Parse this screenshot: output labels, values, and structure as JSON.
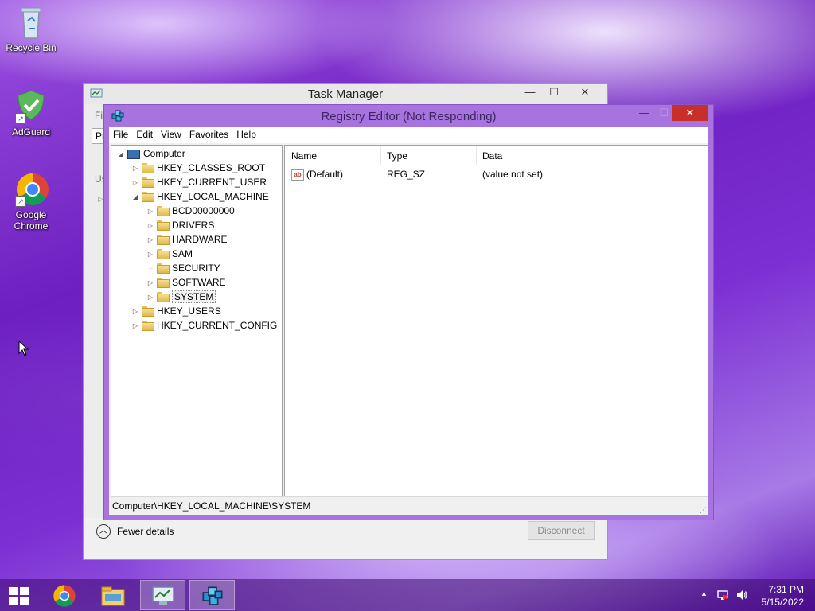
{
  "desktop": {
    "icons": [
      {
        "label": "Recycle Bin"
      },
      {
        "label": "AdGuard"
      },
      {
        "label": "Google Chrome"
      }
    ]
  },
  "task_manager": {
    "title": "Task Manager",
    "fragments": {
      "menu": "Fi",
      "tab": "Pr",
      "user": "Us"
    },
    "fewer_details": "Fewer details",
    "disconnect_label": "Disconnect"
  },
  "registry_editor": {
    "title": "Registry Editor (Not Responding)",
    "menu": [
      "File",
      "Edit",
      "View",
      "Favorites",
      "Help"
    ],
    "tree": {
      "root": "Computer",
      "hives": [
        "HKEY_CLASSES_ROOT",
        "HKEY_CURRENT_USER",
        "HKEY_LOCAL_MACHINE"
      ],
      "local_machine_children": [
        "BCD00000000",
        "DRIVERS",
        "HARDWARE",
        "SAM",
        "SECURITY",
        "SOFTWARE",
        "SYSTEM"
      ],
      "more_hives": [
        "HKEY_USERS",
        "HKEY_CURRENT_CONFIG"
      ]
    },
    "columns": {
      "name": "Name",
      "type": "Type",
      "data": "Data"
    },
    "values": [
      {
        "name": "(Default)",
        "type": "REG_SZ",
        "data": "(value not set)"
      }
    ],
    "status_path": "Computer\\HKEY_LOCAL_MACHINE\\SYSTEM"
  },
  "taskbar": {
    "time": "7:31 PM",
    "date": "5/15/2022"
  },
  "colors": {
    "accent": "#a773df",
    "close": "#c7302a"
  }
}
